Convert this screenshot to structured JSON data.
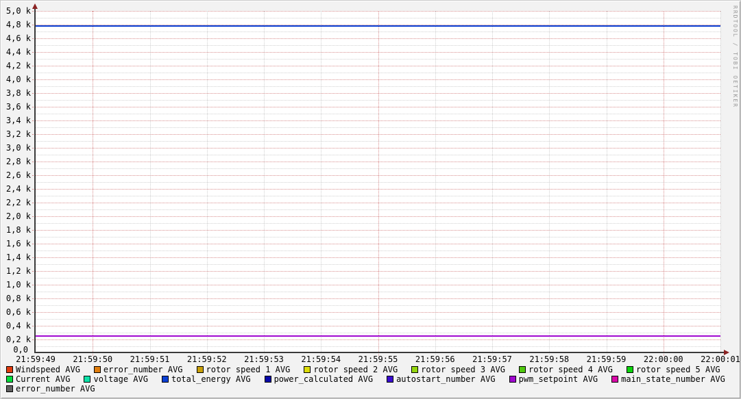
{
  "watermark": "RRDTOOL / TOBI OETIKER",
  "chart_data": {
    "type": "line",
    "title": "",
    "xlabel": "",
    "ylabel": "",
    "x_tick_labels": [
      "21:59:49",
      "21:59:50",
      "21:59:51",
      "21:59:52",
      "21:59:53",
      "21:59:54",
      "21:59:55",
      "21:59:56",
      "21:59:57",
      "21:59:58",
      "21:59:59",
      "22:00:00",
      "22:00:01"
    ],
    "x_major_tick_labels": [
      "21:59:50",
      "21:59:55",
      "22:00:00"
    ],
    "y_tick_labels": [
      "0,2 k",
      "0,4 k",
      "0,6 k",
      "0,8 k",
      "1,0 k",
      "1,2 k",
      "1,4 k",
      "1,6 k",
      "1,8 k",
      "2,0 k",
      "2,2 k",
      "2,4 k",
      "2,6 k",
      "2,8 k",
      "3,0 k",
      "3,2 k",
      "3,4 k",
      "3,6 k",
      "3,8 k",
      "4,0 k",
      "4,2 k",
      "4,4 k",
      "4,6 k",
      "4,8 k",
      "5,0 k"
    ],
    "origin_label": "0,0",
    "ylim": [
      0,
      5000
    ],
    "y_major_step": 200,
    "y_minor_step": 100,
    "grid": {
      "major_color": "#d98f8f",
      "minor_color": "#d2d2d2",
      "style": "dotted"
    },
    "series": [
      {
        "name": "Windspeed AVG",
        "color": "#e13a0e",
        "value": 0,
        "visible": false
      },
      {
        "name": "error_number AVG",
        "color": "#e07d0e",
        "value": 0,
        "visible": false
      },
      {
        "name": "rotor speed 1 AVG",
        "color": "#c8a008",
        "value": 0,
        "visible": false
      },
      {
        "name": "rotor speed 2 AVG",
        "color": "#dcdc0a",
        "value": 0,
        "visible": false
      },
      {
        "name": "rotor speed 3 AVG",
        "color": "#94d60e",
        "value": 0,
        "visible": false
      },
      {
        "name": "rotor speed 4 AVG",
        "color": "#4fc80e",
        "value": 0,
        "visible": false
      },
      {
        "name": "rotor speed 5 AVG",
        "color": "#0cd50c",
        "value": 0,
        "visible": false
      },
      {
        "name": "Current AVG",
        "color": "#00dc3c",
        "value": 0,
        "visible": false
      },
      {
        "name": "voltage AVG",
        "color": "#0ee0a8",
        "value": 0,
        "visible": false
      },
      {
        "name": "total_energy AVG",
        "color": "#0a3fd3",
        "value": 4780,
        "visible": true
      },
      {
        "name": "power_calculated AVG",
        "color": "#0808a8",
        "value": 0,
        "visible": false
      },
      {
        "name": "autostart_number AVG",
        "color": "#3a0bd0",
        "value": 0,
        "visible": false
      },
      {
        "name": "pwm_setpoint AVG",
        "color": "#a008d0",
        "value": 255,
        "visible": true
      },
      {
        "name": "main_state_number AVG",
        "color": "#d808a8",
        "value": 0,
        "visible": false
      },
      {
        "name": "error_number AVG",
        "color": "#606060",
        "value": 0,
        "visible": false
      }
    ]
  },
  "legend": {
    "rows": [
      [
        {
          "label": "Windspeed AVG",
          "color": "#e13a0e"
        },
        {
          "label": "error_number AVG",
          "color": "#e07d0e"
        },
        {
          "label": "rotor speed 1 AVG",
          "color": "#c8a008"
        },
        {
          "label": "rotor speed 2 AVG",
          "color": "#dcdc0a"
        },
        {
          "label": "rotor speed 3 AVG",
          "color": "#94d60e"
        },
        {
          "label": "rotor speed 4 AVG",
          "color": "#4fc80e"
        },
        {
          "label": "rotor speed 5 AVG",
          "color": "#0cd50c"
        }
      ],
      [
        {
          "label": "Current AVG",
          "color": "#00dc3c"
        },
        {
          "label": "voltage AVG",
          "color": "#0ee0a8"
        },
        {
          "label": "total_energy AVG",
          "color": "#0a3fd3"
        },
        {
          "label": "power_calculated AVG",
          "color": "#0808a8"
        },
        {
          "label": "autostart_number AVG",
          "color": "#3a0bd0"
        },
        {
          "label": "pwm_setpoint AVG",
          "color": "#a008d0"
        },
        {
          "label": "main_state_number AVG",
          "color": "#d808a8"
        }
      ],
      [
        {
          "label": "error_number AVG",
          "color": "#606060"
        }
      ]
    ]
  }
}
